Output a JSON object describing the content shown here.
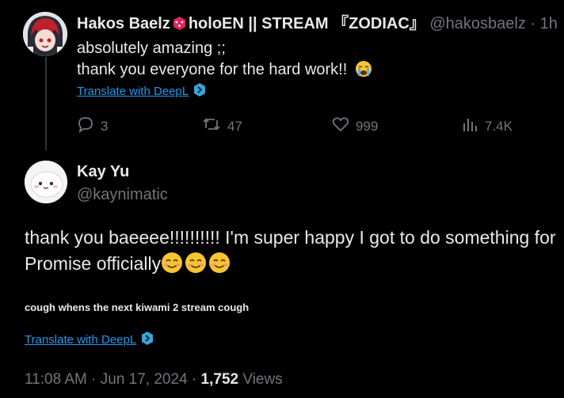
{
  "parent": {
    "display_name": "Hakos Baelz",
    "display_name_rest": "holoEN || STREAM 『ZODIAC』",
    "handle": "@hakosbaelz",
    "sep": "·",
    "time": "1h",
    "line1": "absolutely amazing ;;",
    "line2": "thank you everyone for the hard work!!",
    "translate": "Translate with DeepL",
    "replies": "3",
    "reposts": "47",
    "likes": "999",
    "views": "7.4K"
  },
  "reply": {
    "display_name": "Kay Yu",
    "handle": "@kaynimatic",
    "line1": "thank you baeeee!!!!!!!!!! I'm super happy I got to do something for",
    "line2": "Promise officially",
    "small_text": "cough whens the next kiwami 2 stream cough",
    "translate": "Translate with DeepL",
    "time": "11:08 AM",
    "date": "Jun 17, 2024",
    "views_count": "1,752",
    "views_label": "Views",
    "dot": "·"
  },
  "icons": {
    "dice": "dice-icon",
    "crying": "loudly-crying-face-icon",
    "smile": "smiling-face-icon",
    "deepl": "deepl-icon",
    "reply": "reply-icon",
    "repost": "repost-icon",
    "like": "heart-icon",
    "views": "views-icon"
  },
  "colors": {
    "background": "#000000",
    "text": "#e7e9ea",
    "muted": "#71767b",
    "link": "#1d9bf0",
    "emoji": "#f7c531"
  }
}
